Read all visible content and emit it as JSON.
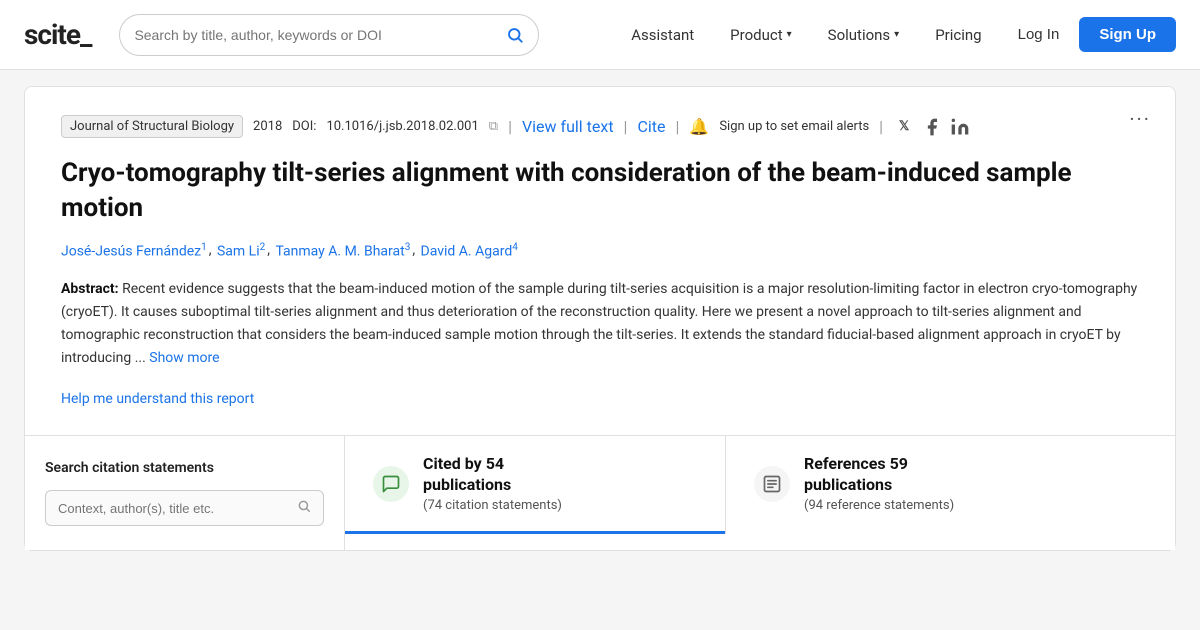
{
  "header": {
    "logo": "scite_",
    "search_placeholder": "Search by title, author, keywords or DOI",
    "nav": {
      "assistant": "Assistant",
      "product": "Product",
      "solutions": "Solutions",
      "pricing": "Pricing",
      "login": "Log In",
      "signup": "Sign Up"
    }
  },
  "paper": {
    "journal": "Journal of Structural Biology",
    "year": "2018",
    "doi_label": "DOI:",
    "doi": "10.1016/j.jsb.2018.02.001",
    "view_full_text": "View full text",
    "cite": "Cite",
    "alert_text": "Sign up to set email alerts",
    "more_button": "···",
    "title": "Cryo-tomography tilt-series alignment with consideration of the beam-induced sample motion",
    "authors": [
      {
        "name": "José-Jesús Fernández",
        "sup": "1"
      },
      {
        "name": "Sam Li",
        "sup": "2"
      },
      {
        "name": "Tanmay A. M. Bharat",
        "sup": "3"
      },
      {
        "name": "David A. Agard",
        "sup": "4"
      }
    ],
    "abstract_label": "Abstract:",
    "abstract_text": "Recent evidence suggests that the beam-induced motion of the sample during tilt-series acquisition is a major resolution-limiting factor in electron cryo-tomography (cryoET). It causes suboptimal tilt-series alignment and thus deterioration of the reconstruction quality. Here we present a novel approach to tilt-series alignment and tomographic reconstruction that considers the beam-induced sample motion through the tilt-series. It extends the standard fiducial-based alignment approach in cryoET by introducing ...",
    "show_more": "Show more",
    "help_link": "Help me understand this report"
  },
  "bottom": {
    "search_panel": {
      "title": "Search citation statements",
      "input_placeholder": "Context, author(s), title etc."
    },
    "cited_tab": {
      "label_line1": "Cited by 54",
      "label_line2": "publications",
      "sublabel": "(74 citation statements)"
    },
    "refs_tab": {
      "label_line1": "References 59",
      "label_line2": "publications",
      "sublabel": "(94 reference statements)"
    }
  },
  "icons": {
    "search": "🔍",
    "bell": "🔔",
    "twitter": "𝕏",
    "facebook": "f",
    "linkedin": "in",
    "copy": "⧉",
    "chat_bubble": "💬",
    "document": "📄"
  }
}
